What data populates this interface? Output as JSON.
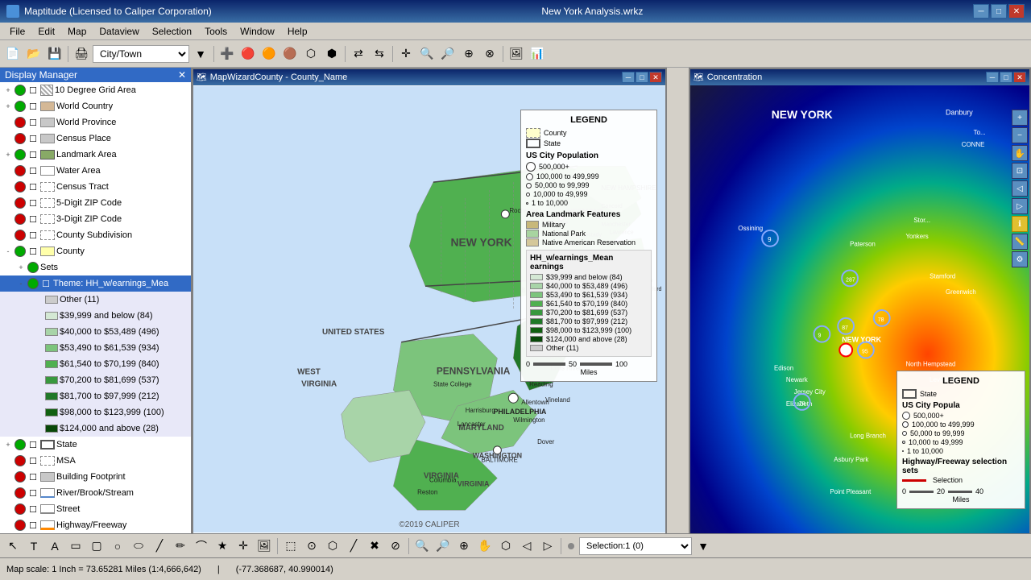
{
  "app": {
    "title": "Maptitude (Licensed to Caliper Corporation)",
    "center_title": "New York Analysis.wrkz",
    "icon": "map-icon"
  },
  "menu": {
    "items": [
      "File",
      "Edit",
      "Map",
      "Dataview",
      "Selection",
      "Tools",
      "Window",
      "Help"
    ]
  },
  "toolbar": {
    "dropdown_value": "City/Town"
  },
  "display_manager": {
    "title": "Display Manager",
    "layers": [
      {
        "id": "grid",
        "name": "10 Degree Grid Area",
        "visible": true,
        "indent": 0,
        "expand": true
      },
      {
        "id": "world_country",
        "name": "World Country",
        "visible": true,
        "indent": 0,
        "expand": true
      },
      {
        "id": "world_province",
        "name": "World Province",
        "visible": false,
        "indent": 0
      },
      {
        "id": "census_place",
        "name": "Census Place",
        "visible": false,
        "indent": 0
      },
      {
        "id": "landmark_area",
        "name": "Landmark Area",
        "visible": true,
        "indent": 0
      },
      {
        "id": "water_area",
        "name": "Water Area",
        "visible": false,
        "indent": 0
      },
      {
        "id": "census_tract",
        "name": "Census Tract",
        "visible": false,
        "indent": 0
      },
      {
        "id": "zip5",
        "name": "5-Digit ZIP Code",
        "visible": false,
        "indent": 0
      },
      {
        "id": "zip3",
        "name": "3-Digit ZIP Code",
        "visible": false,
        "indent": 0
      },
      {
        "id": "county_sub",
        "name": "County Subdivision",
        "visible": false,
        "indent": 0
      },
      {
        "id": "county",
        "name": "County",
        "visible": true,
        "indent": 0,
        "expand": true
      },
      {
        "id": "sets",
        "name": "Sets",
        "visible": true,
        "indent": 1
      },
      {
        "id": "theme_hh",
        "name": "Theme: HH_w/earnings_Mea",
        "visible": true,
        "indent": 1,
        "selected": true
      },
      {
        "id": "other11",
        "name": "Other (11)",
        "visible": true,
        "indent": 2
      },
      {
        "id": "c39999",
        "name": "$39,999 and below (84)",
        "visible": true,
        "indent": 2
      },
      {
        "id": "c40000",
        "name": "$40,000 to $53,489 (496)",
        "visible": true,
        "indent": 2
      },
      {
        "id": "c53490",
        "name": "$53,490 to $61,539 (934)",
        "visible": true,
        "indent": 2
      },
      {
        "id": "c61540",
        "name": "$61,540 to $70,199 (840)",
        "visible": true,
        "indent": 2
      },
      {
        "id": "c70200",
        "name": "$70,200 to $81,699 (537)",
        "visible": true,
        "indent": 2
      },
      {
        "id": "c81700",
        "name": "$81,700 to $97,999 (212)",
        "visible": true,
        "indent": 2
      },
      {
        "id": "c98000",
        "name": "$98,000 to $123,999 (100)",
        "visible": true,
        "indent": 2
      },
      {
        "id": "c124000",
        "name": "$124,000 and above (28)",
        "visible": true,
        "indent": 2
      },
      {
        "id": "state",
        "name": "State",
        "visible": true,
        "indent": 0,
        "expand": true
      },
      {
        "id": "msa",
        "name": "MSA",
        "visible": false,
        "indent": 0
      },
      {
        "id": "building",
        "name": "Building Footprint",
        "visible": false,
        "indent": 0
      },
      {
        "id": "river",
        "name": "River/Brook/Stream",
        "visible": false,
        "indent": 0
      },
      {
        "id": "street",
        "name": "Street",
        "visible": false,
        "indent": 0
      },
      {
        "id": "highway",
        "name": "Highway/Freeway",
        "visible": false,
        "indent": 0
      }
    ]
  },
  "map_window1": {
    "title": "MapWizardCounty - County_Name",
    "copyright": "©2019 CALIPER"
  },
  "legend1": {
    "title": "LEGEND",
    "county_label": "County",
    "state_label": "State",
    "population_title": "US City Population",
    "pop_items": [
      {
        "label": "500,000+",
        "size": 12
      },
      {
        "label": "100,000 to 499,999",
        "size": 9
      },
      {
        "label": "50,000 to 99,999",
        "size": 7
      },
      {
        "label": "10,000 to 49,999",
        "size": 5
      },
      {
        "label": "1 to 10,000",
        "size": 3
      }
    ],
    "landmark_title": "Area Landmark Features",
    "landmark_items": [
      "Military",
      "National Park",
      "Native American Reservation"
    ],
    "hh_title": "HH_w/earnings_Mean earnings",
    "hh_items": [
      "$39,999 and below (84)",
      "$40,000 to $53,489 (496)",
      "$53,490 to $61,539 (934)",
      "$61,540 to $70,199 (840)",
      "$70,200 to $81,699 (537)",
      "$81,700 to $97,999 (212)",
      "$98,000 to $123,999 (100)",
      "$124,000 and above (28)",
      "Other (11)"
    ],
    "scale_0": "0",
    "scale_50": "50",
    "scale_100": "100",
    "scale_unit": "Miles"
  },
  "map_window2": {
    "title": "Concentration"
  },
  "legend2": {
    "title": "LEGEND",
    "state_label": "State",
    "pop_title": "US City Popula",
    "pop_items": [
      "500,000+",
      "100,000 to 499,999",
      "50,000 to 99,999",
      "10,000 to 49,999",
      "1 to 10,000"
    ],
    "highway_label": "Highway/Freeway selection sets",
    "selection_label": "Selection",
    "scale_0": "0",
    "scale_20": "20",
    "scale_40": "40",
    "scale_unit": "Miles"
  },
  "status_bar": {
    "scale": "Map scale: 1 Inch = 73.65281 Miles (1:4,666,642)",
    "coords": "(-77.368687, 40.990014)"
  },
  "selection_bar": {
    "label": "Selection:1 (0)"
  }
}
